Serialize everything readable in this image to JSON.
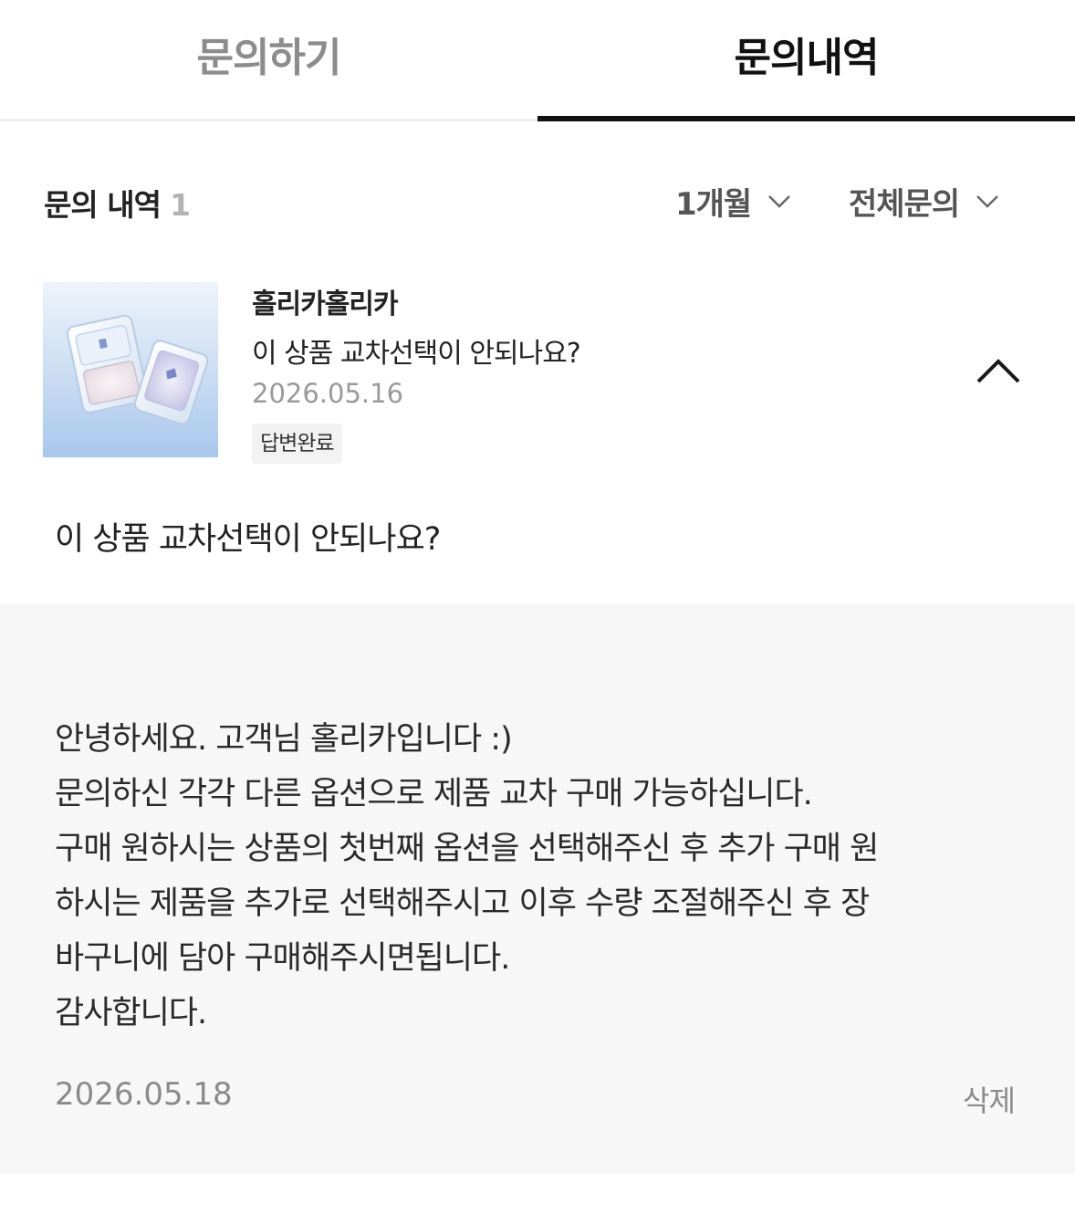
{
  "tabs": {
    "inquire": "문의하기",
    "history": "문의내역",
    "active": "history"
  },
  "list_header": {
    "title": "문의 내역",
    "count": "1",
    "period_filter": "1개월",
    "type_filter": "전체문의"
  },
  "inquiry": {
    "brand": "홀리카홀리카",
    "subject": "이 상품 교차선택이 안되나요?",
    "date": "2026.05.16",
    "status": "답변완료",
    "question": "이 상품 교차선택이 안되나요?"
  },
  "answer": {
    "lines": [
      "안녕하세요. 고객님 홀리카입니다 :)",
      "문의하신 각각 다른 옵션으로 제품 교차 구매 가능하십니다.",
      "구매 원하시는 상품의 첫번째 옵션을 선택해주신 후 추가 구매 원",
      "하시는 제품을 추가로 선택해주시고 이후 수량 조절해주신 후 장",
      "바구니에 담아 구매해주시면됩니다.",
      "감사합니다."
    ],
    "date": "2026.05.18",
    "delete_label": "삭제"
  },
  "icons": {
    "period_dropdown": "chevron-down-icon",
    "type_dropdown": "chevron-down-icon",
    "collapse": "chevron-up-icon"
  },
  "colors": {
    "active_tab": "#111111",
    "inactive_tab": "#8c8c8c",
    "answer_background": "#f7f7f7",
    "badge_background": "#f2f2f2"
  }
}
